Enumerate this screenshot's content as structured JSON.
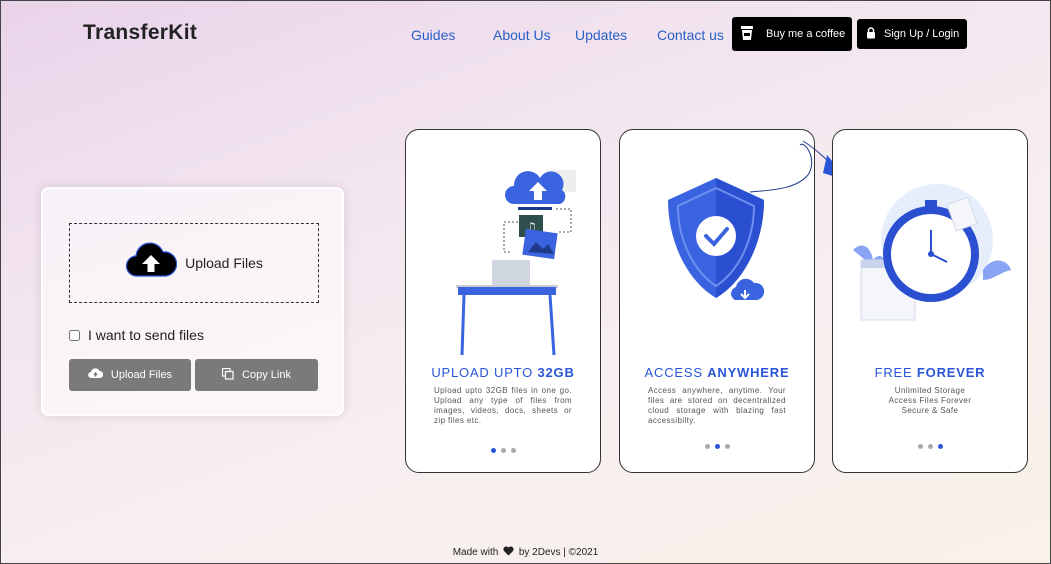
{
  "header": {
    "logo": "TransferKit",
    "nav": [
      "Guides",
      "About Us",
      "Updates",
      "Contact us"
    ],
    "coffee_label": "Buy me a coffee",
    "login_label": "Sign Up / Login"
  },
  "upload": {
    "dropzone_label": "Upload Files",
    "checkbox_label": "I want to send files",
    "upload_button": "Upload Files",
    "copy_button": "Copy Link"
  },
  "features": [
    {
      "title_plain": "UPLOAD UPTO ",
      "title_bold": "32GB",
      "desc": "Upload upto 32GB files in one go. Upload any type of files from images, videos, docs, sheets or zip files etc.",
      "active_dot": 0
    },
    {
      "title_plain": "ACCESS ",
      "title_bold": "ANYWHERE",
      "desc": "Access anywhere, anytime. Your files are stored on decentralized cloud storage with blazing fast accessibilty.",
      "active_dot": 1
    },
    {
      "title_plain": "FREE ",
      "title_bold": "FOREVER",
      "desc_lines": [
        "Unlimited Storage",
        "Access Files Forever",
        "Secure & Safe"
      ],
      "active_dot": 2
    }
  ],
  "footer": {
    "before": "Made with",
    "after": "by 2Devs | ©2021"
  },
  "colors": {
    "accent": "#2a55d8",
    "nav": "#2a5fc8",
    "button_gray": "#7a7a7a"
  }
}
